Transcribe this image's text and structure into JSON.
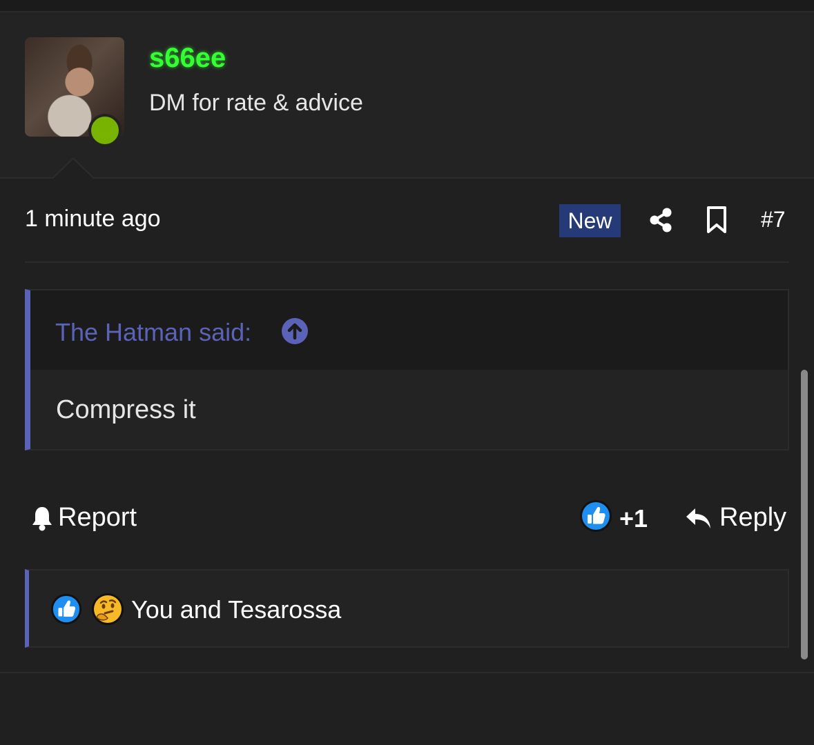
{
  "post": {
    "username": "s66ee",
    "user_title": "DM for rate & advice",
    "username_color": "#33ff33",
    "online_status_color": "#77b300",
    "timestamp": "1 minute ago",
    "badge": "New",
    "badge_color": "#273a78",
    "post_number": "#7",
    "icons": [
      "share-icon",
      "bookmark-icon"
    ]
  },
  "quote": {
    "author_label": "The Hatman said:",
    "body": "Compress it",
    "accent_color": "#5a63b8",
    "icon": "arrow-up-circle-icon"
  },
  "actions": {
    "report_label": "Report",
    "like_count": "+1",
    "reply_label": "Reply",
    "icons": [
      "bell-icon",
      "thumbs-up-icon",
      "reply-arrow-icon"
    ]
  },
  "reactions": {
    "text": "You and Tesarossa",
    "icons": [
      "thumbs-up-icon",
      "thinking-face-icon"
    ]
  }
}
